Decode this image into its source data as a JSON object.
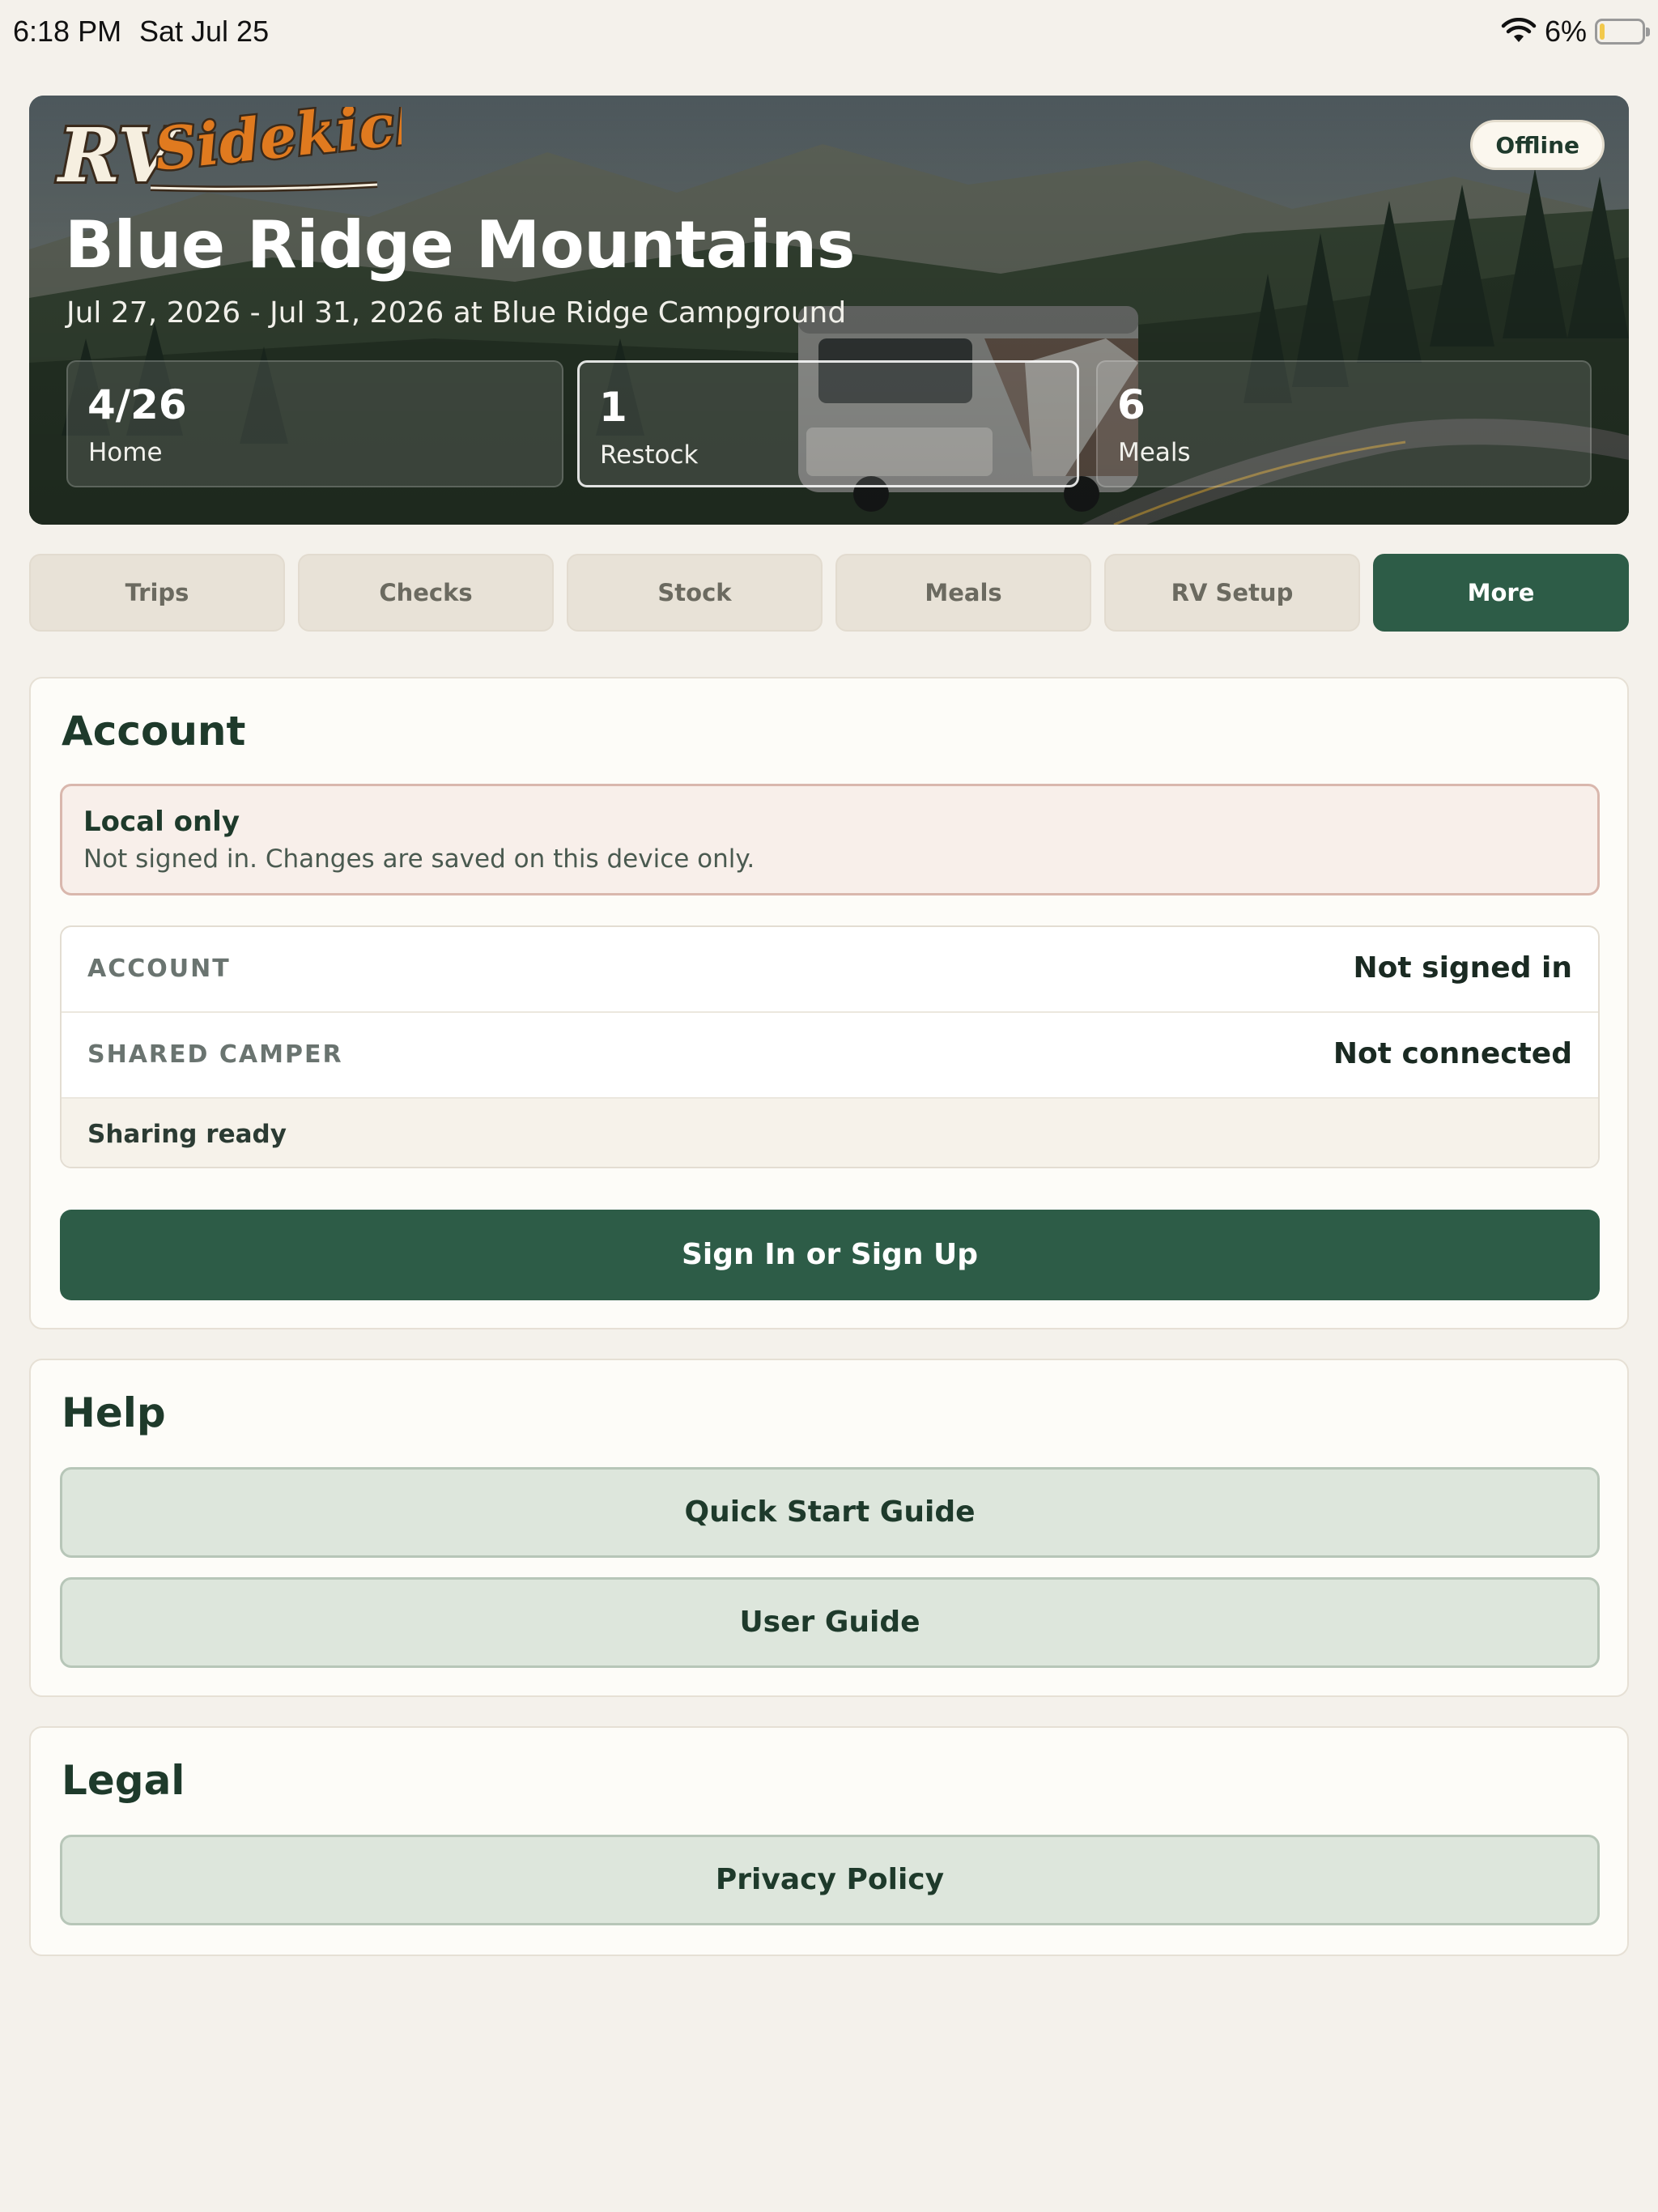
{
  "status_bar": {
    "time": "6:18 PM",
    "date": "Sat Jul 25",
    "battery": "6%",
    "battery_level": 0.06
  },
  "hero": {
    "logo_text": "RVSidekick",
    "badge": "Offline",
    "title": "Blue Ridge Mountains",
    "subtitle": "Jul 27, 2026 - Jul 31, 2026 at Blue Ridge Campground",
    "stats": [
      {
        "value": "4/26",
        "label": "Home"
      },
      {
        "value": "1",
        "label": "Restock"
      },
      {
        "value": "6",
        "label": "Meals"
      }
    ]
  },
  "tabs": [
    {
      "label": "Trips"
    },
    {
      "label": "Checks"
    },
    {
      "label": "Stock"
    },
    {
      "label": "Meals"
    },
    {
      "label": "RV Setup"
    },
    {
      "label": "More",
      "selected": true
    }
  ],
  "account": {
    "title": "Account",
    "notice_title": "Local only",
    "notice_body": "Not signed in. Changes are saved on this device only.",
    "rows": [
      {
        "key": "ACCOUNT",
        "value": "Not signed in"
      },
      {
        "key": "SHARED CAMPER",
        "value": "Not connected"
      }
    ],
    "footer": "Sharing ready",
    "button": "Sign In or Sign Up"
  },
  "help": {
    "title": "Help",
    "buttons": [
      {
        "label": "Quick Start Guide"
      },
      {
        "label": "User Guide"
      }
    ]
  },
  "legal": {
    "title": "Legal",
    "buttons": [
      {
        "label": "Privacy Policy"
      }
    ]
  },
  "colors": {
    "primary": "#2d5c47",
    "background": "#f4f1eb",
    "logo_orange": "#e07a1f"
  }
}
